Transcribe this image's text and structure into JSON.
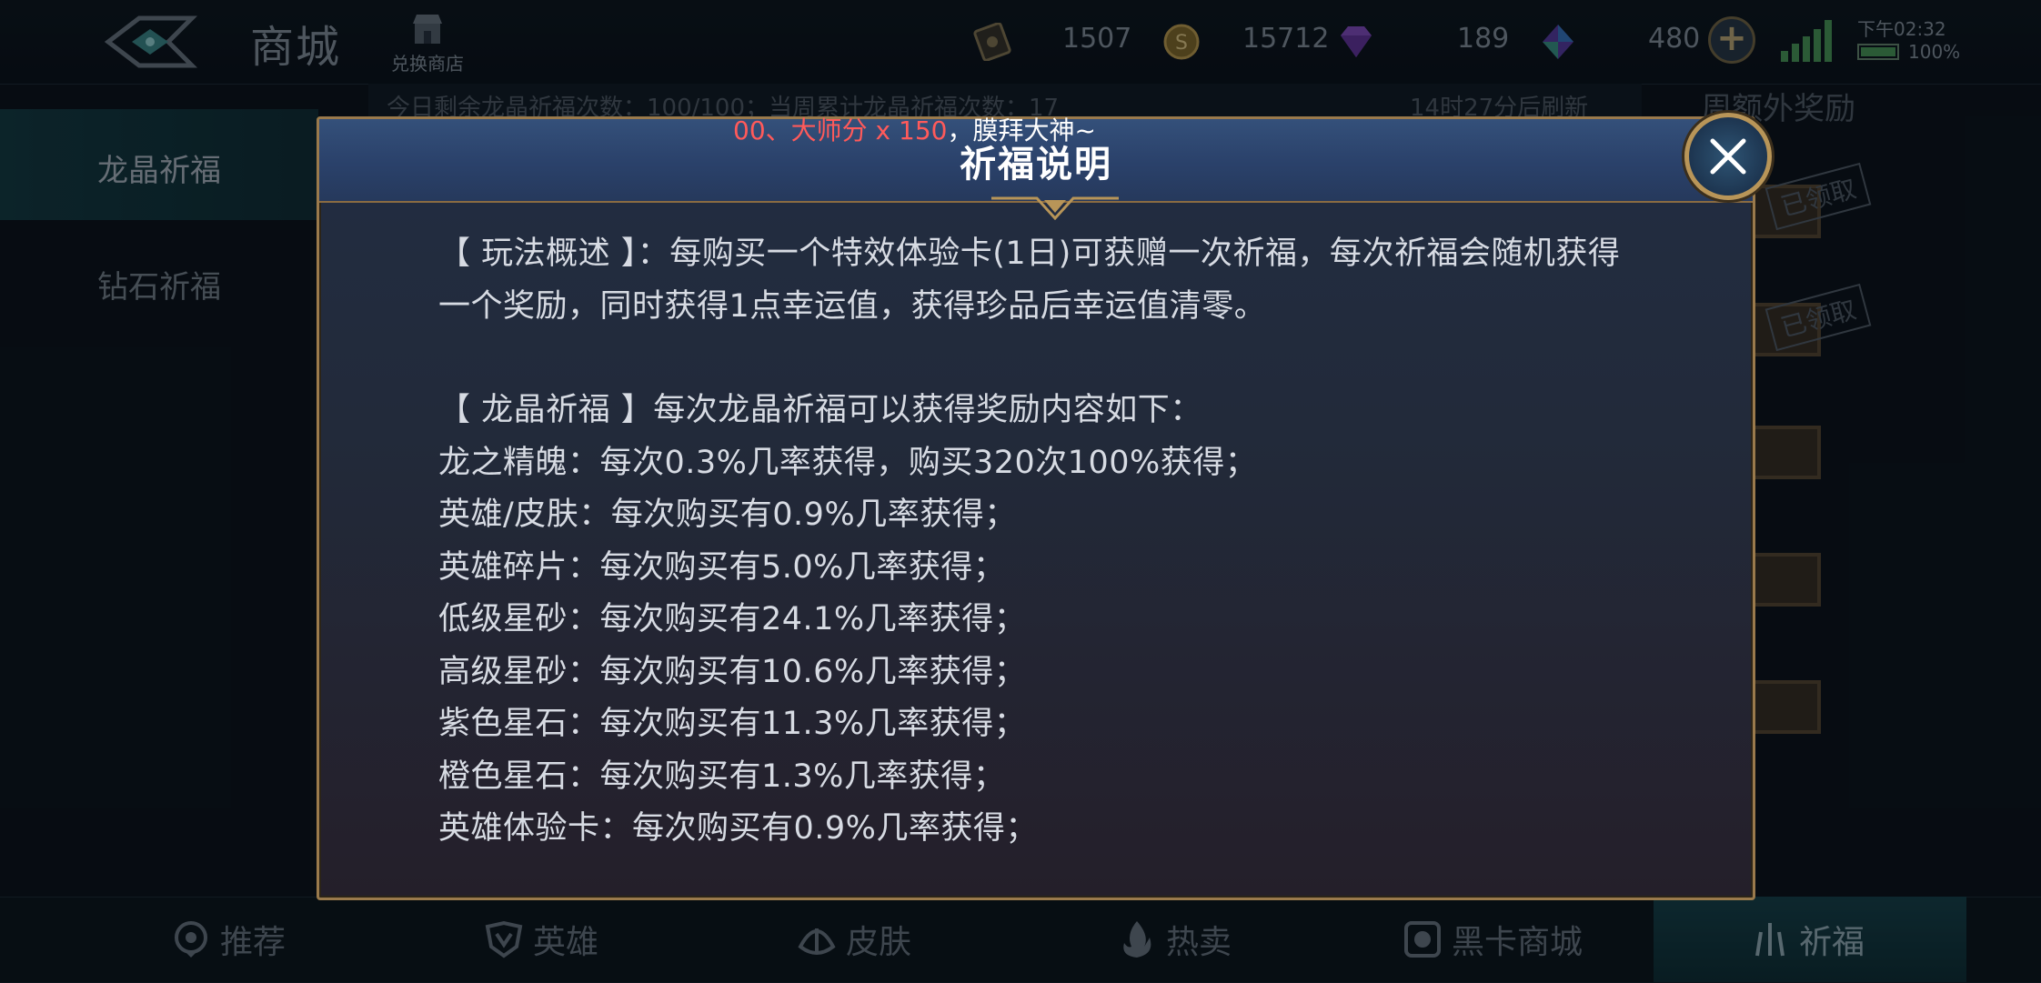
{
  "header": {
    "title": "商城",
    "exchange_label": "兑换商店",
    "currencies": [
      {
        "icon": "ticket-icon",
        "value": "1507"
      },
      {
        "icon": "gold-coin-icon",
        "value": "15712"
      },
      {
        "icon": "purple-diamond-icon",
        "value": "189"
      },
      {
        "icon": "crystal-icon",
        "value": "480"
      }
    ],
    "time": "下午02:32",
    "battery": "100%"
  },
  "background": {
    "sidebar": [
      "龙晶祈福",
      "钻石祈福"
    ],
    "info_text": "今日剩余龙晶祈福次数：100/100；当周累计龙晶祈福次数：17",
    "refresh_text": "14时27分后刷新",
    "weekly_title": "周额外奖励",
    "claimed_label": "已领取"
  },
  "marquee": {
    "red_part": "00、大师分 x 150",
    "white_part": "，膜拜大神~"
  },
  "modal": {
    "title": "祈福说明",
    "lines": [
      "【 玩法概述 】：每购买一个特效体验卡(1日)可获赠一次祈福，每次祈福会随机获得",
      "一个奖励，同时获得1点幸运值，获得珍品后幸运值清零。",
      "【 龙晶祈福 】每次龙晶祈福可以获得奖励内容如下：",
      "龙之精魄：每次0.3%几率获得，购买320次100%获得；",
      "英雄/皮肤：每次购买有0.9%几率获得；",
      "英雄碎片：每次购买有5.0%几率获得；",
      "低级星砂：每次购买有24.1%几率获得；",
      "高级星砂：每次购买有10.6%几率获得；",
      "紫色星石：每次购买有11.3%几率获得；",
      "橙色星石：每次购买有1.3%几率获得；",
      "英雄体验卡：每次购买有0.9%几率获得；"
    ]
  },
  "bottom_nav": [
    {
      "label": "推荐",
      "icon": "recommend-icon"
    },
    {
      "label": "英雄",
      "icon": "hero-icon"
    },
    {
      "label": "皮肤",
      "icon": "skin-icon"
    },
    {
      "label": "热卖",
      "icon": "hot-sale-icon"
    },
    {
      "label": "黑卡商城",
      "icon": "black-card-icon"
    },
    {
      "label": "祈福",
      "icon": "blessing-icon"
    }
  ]
}
